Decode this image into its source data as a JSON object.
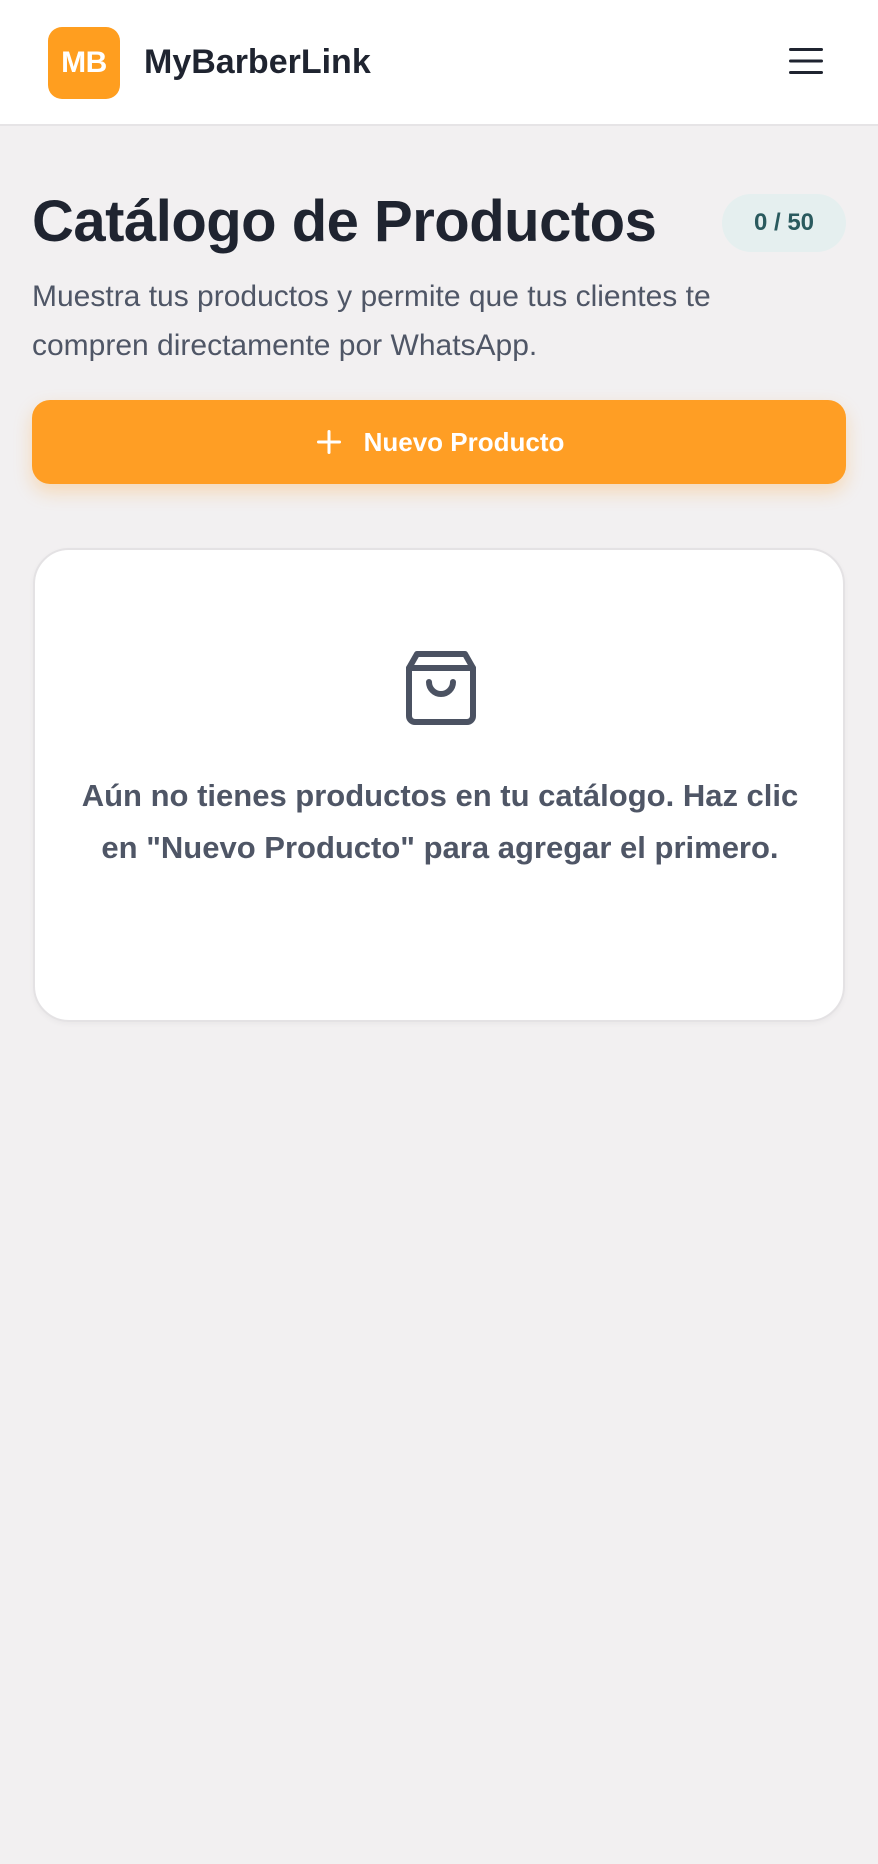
{
  "header": {
    "logo_initials": "MB",
    "brand_name": "MyBarberLink",
    "menu_icon": "hamburger-menu-icon"
  },
  "page": {
    "title": "Catálogo de Productos",
    "count_badge": "0 / 50",
    "subtitle": "Muestra tus productos y permite que tus clientes te compren directamente por WhatsApp."
  },
  "actions": {
    "new_product_label": "Nuevo Producto",
    "new_product_icon": "plus-icon"
  },
  "empty_state": {
    "icon": "shopping-bag-icon",
    "message": "Aún no tienes productos en tu catálogo. Haz clic en \"Nuevo Producto\" para agregar el primero."
  },
  "colors": {
    "accent": "#ff9e1f",
    "background": "#f2f0f1",
    "badge_bg": "#e5efef",
    "badge_text": "#2a5a5e",
    "text_primary": "#1f2430",
    "text_secondary": "#4f5666"
  }
}
